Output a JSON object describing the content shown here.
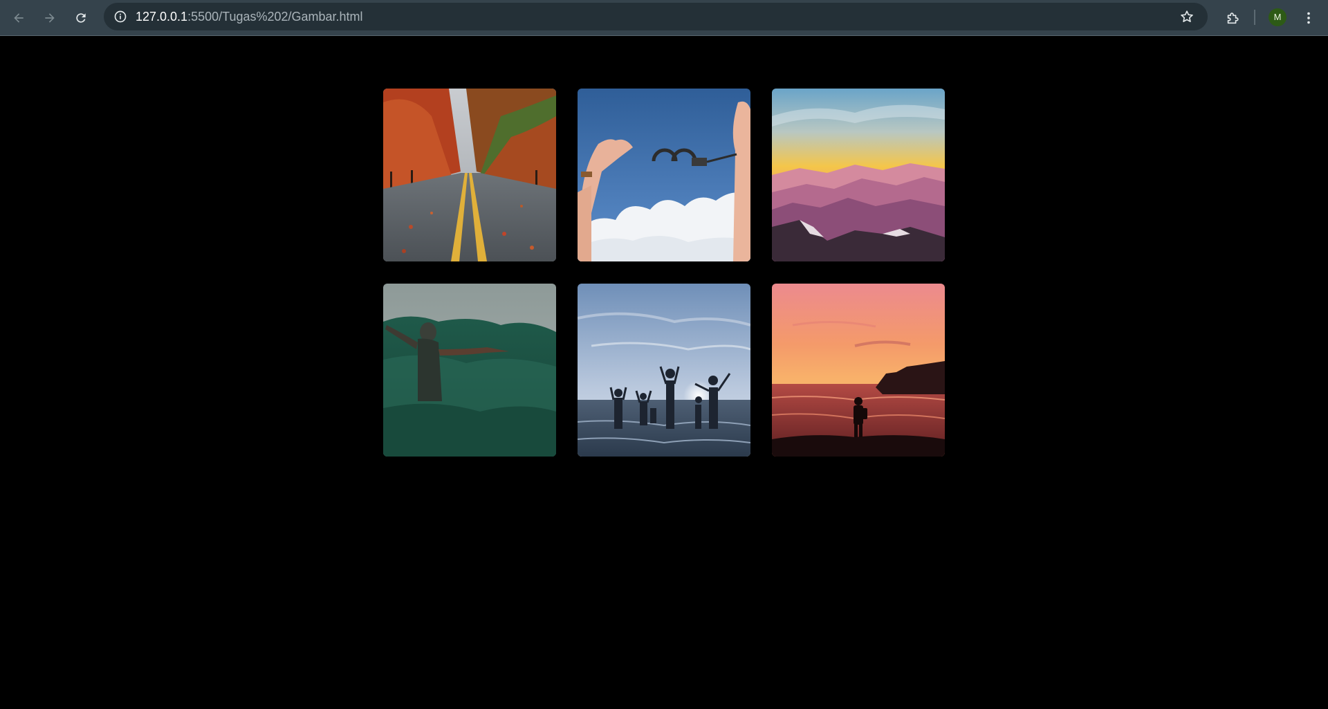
{
  "browser": {
    "url_host": "127.0.0.1",
    "url_rest": ":5500/Tugas%202/Gambar.html",
    "profile_initial": "M",
    "icons": [
      "back-arrow-icon",
      "forward-arrow-icon",
      "reload-icon",
      "site-info-icon",
      "bookmark-star-icon",
      "extensions-puzzle-icon",
      "kebab-menu-icon"
    ]
  },
  "gallery": {
    "photos": [
      {
        "name": "autumn-road-photo"
      },
      {
        "name": "handcuffs-sky-photo"
      },
      {
        "name": "sunset-mountains-photo"
      },
      {
        "name": "person-in-greenery-photo"
      },
      {
        "name": "beach-silhouettes-photo"
      },
      {
        "name": "ocean-sunset-silhouette-photo"
      }
    ]
  },
  "colors": {
    "page_background": "#000000",
    "toolbar": "#35434c",
    "omnibox": "#243037",
    "avatar": "#2d5a16"
  }
}
